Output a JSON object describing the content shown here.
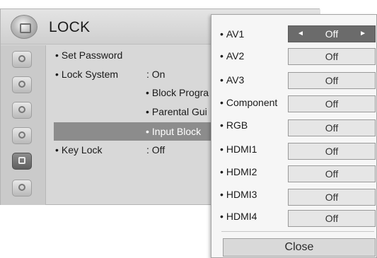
{
  "menu": {
    "title": "LOCK",
    "items": [
      {
        "label": "Set Password",
        "value": ""
      },
      {
        "label": "Lock System",
        "value": ": On"
      },
      {
        "label": "Key Lock",
        "value": ": Off"
      }
    ],
    "sub_items": [
      "Block Progra",
      "Parental Gui",
      "Input Block"
    ],
    "selected_sub_item": "Input Block"
  },
  "sidebar": {
    "icons": [
      "picture-icon",
      "audio-icon",
      "time-icon",
      "option-icon",
      "lock-icon",
      "usb-icon"
    ],
    "selected": "lock-icon"
  },
  "input_block": {
    "rows": [
      {
        "label": "AV1",
        "value": "Off",
        "selected": true
      },
      {
        "label": "AV2",
        "value": "Off"
      },
      {
        "label": "AV3",
        "value": "Off"
      },
      {
        "label": "Component",
        "value": "Off"
      },
      {
        "label": "RGB",
        "value": "Off"
      },
      {
        "label": "HDMI1",
        "value": "Off"
      },
      {
        "label": "HDMI2",
        "value": "Off"
      },
      {
        "label": "HDMI3",
        "value": "Off"
      },
      {
        "label": "HDMI4",
        "value": "Off"
      }
    ],
    "arrow_left": "◄",
    "arrow_right": "►",
    "close_label": "Close"
  }
}
